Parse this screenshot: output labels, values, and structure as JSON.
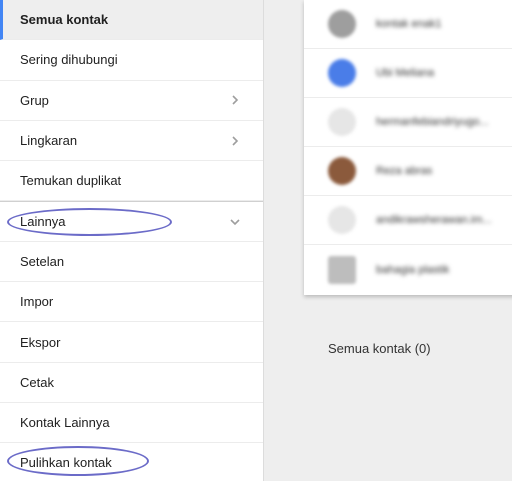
{
  "sidebar": {
    "items": [
      {
        "label": "Semua kontak",
        "active": true,
        "chevron": ""
      },
      {
        "label": "Sering dihubungi",
        "active": false,
        "chevron": ""
      },
      {
        "label": "Grup",
        "active": false,
        "chevron": "chevron-right-icon"
      },
      {
        "label": "Lingkaran",
        "active": false,
        "chevron": "chevron-right-icon"
      },
      {
        "label": "Temukan duplikat",
        "active": false,
        "chevron": ""
      },
      {
        "label": "Lainnya",
        "active": false,
        "chevron": "chevron-down-icon"
      },
      {
        "label": "Setelan",
        "active": false,
        "chevron": ""
      },
      {
        "label": "Impor",
        "active": false,
        "chevron": ""
      },
      {
        "label": "Ekspor",
        "active": false,
        "chevron": ""
      },
      {
        "label": "Cetak",
        "active": false,
        "chevron": ""
      },
      {
        "label": "Kontak Lainnya",
        "active": false,
        "chevron": ""
      },
      {
        "label": "Pulihkan kontak",
        "active": false,
        "chevron": ""
      }
    ]
  },
  "contacts": [
    {
      "name": "kontak enak1",
      "avatar_color": "#9e9e9e"
    },
    {
      "name": "Ubi Meliana",
      "avatar_color": "#4a7de8"
    },
    {
      "name": "hermanfebiandriyugo...",
      "avatar_color": "#e6e6e6"
    },
    {
      "name": "Reza abras",
      "avatar_color": "#8b5a3c"
    },
    {
      "name": "andikrawsherawan.im...",
      "avatar_color": "#e6e6e6"
    },
    {
      "name": "bahagia plastik",
      "avatar_color": "#bdbdbd"
    }
  ],
  "main": {
    "count_label": "Semua kontak (0)"
  },
  "colors": {
    "accent": "#4285f4",
    "highlight": "#6b6bc8"
  }
}
